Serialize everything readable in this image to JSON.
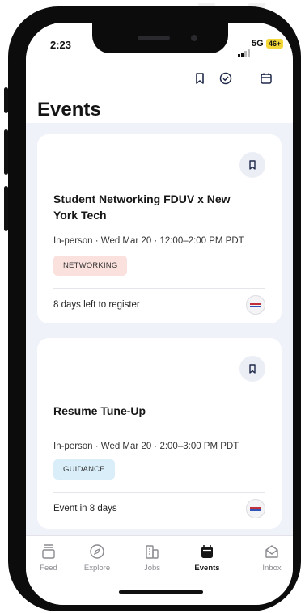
{
  "status_bar": {
    "time": "2:23",
    "network": "5G",
    "battery": "46+"
  },
  "header": {
    "title": "Events"
  },
  "events": [
    {
      "title": "Student Networking FDUV x New York Tech",
      "meta": "In-person · Wed Mar 20 · 12:00–2:00 PM PDT",
      "tag": "NETWORKING",
      "tag_color": "#fbe1dd",
      "footer": "8 days left to register"
    },
    {
      "title": "Resume Tune-Up",
      "meta": "In-person · Wed Mar 20 · 2:00–3:00 PM PDT",
      "tag": "GUIDANCE",
      "tag_color": "#d9eef8",
      "footer": "Event in 8 days"
    }
  ],
  "tabs": [
    {
      "label": "Feed",
      "icon": "feed-icon"
    },
    {
      "label": "Explore",
      "icon": "compass-icon"
    },
    {
      "label": "Jobs",
      "icon": "building-icon"
    },
    {
      "label": "Events",
      "icon": "calendar-icon",
      "active": true
    },
    {
      "label": "Inbox",
      "icon": "inbox-icon"
    }
  ]
}
